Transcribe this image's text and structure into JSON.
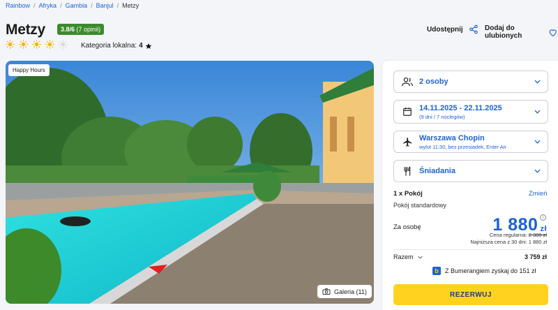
{
  "breadcrumb": {
    "items": [
      "Rainbow",
      "Afryka",
      "Gambia",
      "Banjul"
    ],
    "current": "Metzy"
  },
  "hotel": {
    "name": "Metzy",
    "rating": "3.8/6",
    "reviews": "(7 opinii)",
    "suns": 4,
    "suns_max": 5,
    "local_category_label": "Kategoria lokalna:",
    "local_category_value": "4"
  },
  "actions": {
    "share_label": "Udostępnij",
    "fav_label": "Dodaj do ulubionych"
  },
  "photo": {
    "badge": "Happy Hours",
    "gallery_label": "Galeria (11)"
  },
  "booking": {
    "persons": "2 osoby",
    "dates": "14.11.2025 - 22.11.2025",
    "dates_sub": "(9 dni / 7 noclegów)",
    "departure": "Warszawa Chopin",
    "departure_sub": "wylot 11:30, bez przesiadek, Enter Air",
    "board": "Śniadania",
    "room_count": "1 x Pokój",
    "change_label": "Zmień",
    "room_type": "Pokój standardowy",
    "per_person_label": "Za osobę",
    "price": "1 880",
    "currency": "zł",
    "regular_label": "Cena regularna:",
    "regular_price": "2 380 zł",
    "lowest_label": "Najniższa cena z 30 dni:",
    "lowest_price": "1 880 zł",
    "total_label": "Razem",
    "total": "3 759 zł",
    "boomerang_text": "Z Bumerangiem zyskaj do 151 zł",
    "reserve_label": "REZERWUJ"
  },
  "colors": {
    "accent": "#1d62d6",
    "badge_green": "#3d8a2c",
    "reserve_yellow": "#ffd21f",
    "sun": "#f7b500"
  }
}
